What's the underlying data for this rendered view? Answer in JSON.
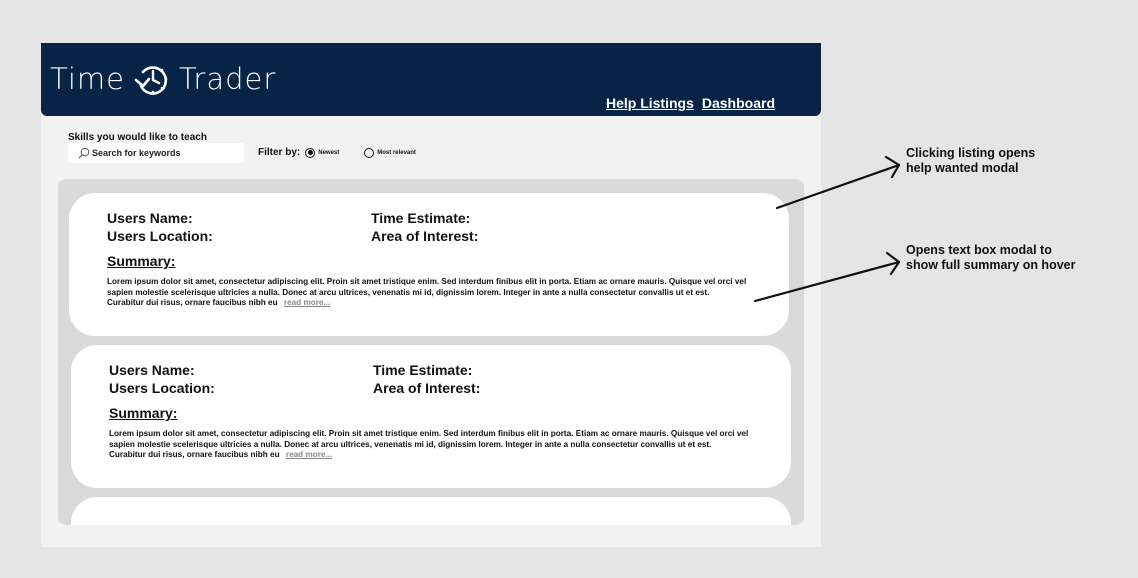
{
  "brand": {
    "left": "Time",
    "right": "Trader",
    "logo_icon": "clock-arrow-icon"
  },
  "nav": {
    "help_listings": "Help Listings",
    "dashboard": "Dashboard"
  },
  "toolbar": {
    "skills_label": "Skills you would like to teach",
    "search_placeholder": "Search for keywords",
    "filter_label": "Filter by:",
    "options": [
      {
        "label": "Newest",
        "selected": true
      },
      {
        "label": "Most relevant",
        "selected": false
      }
    ]
  },
  "listings": [
    {
      "name_label": "Users Name:",
      "location_label": "Users Location:",
      "time_label": "Time Estimate:",
      "area_label": "Area of Interest:",
      "summary_heading": "Summary:",
      "summary_text": "Lorem ipsum dolor sit amet, consectetur adipiscing elit. Proin sit amet tristique enim. Sed interdum finibus elit in porta. Etiam ac ornare mauris. Quisque vel orci vel sapien molestie scelerisque ultricies a nulla. Donec at arcu ultrices, venenatis mi id, dignissim lorem. Integer in ante a nulla consectetur convallis ut et est. Curabitur dui risus, ornare faucibus nibh eu",
      "read_more": "read more..."
    },
    {
      "name_label": "Users Name:",
      "location_label": "Users Location:",
      "time_label": "Time Estimate:",
      "area_label": "Area of Interest:",
      "summary_heading": "Summary:",
      "summary_text": "Lorem ipsum dolor sit amet, consectetur adipiscing elit. Proin sit amet tristique enim. Sed interdum finibus elit in porta. Etiam ac ornare mauris. Quisque vel orci vel sapien molestie scelerisque ultricies a nulla. Donec at arcu ultrices, venenatis mi id, dignissim lorem. Integer in ante a nulla consectetur convallis ut et est. Curabitur dui risus, ornare faucibus nibh eu",
      "read_more": "read more..."
    }
  ],
  "annotations": {
    "note_1_line_1": "Clicking listing opens",
    "note_1_line_2": "help wanted modal",
    "note_2_line_1": "Opens text box modal to",
    "note_2_line_2": "show full summary on hover"
  },
  "colors": {
    "header": "#072446",
    "background": "#e5e5e5",
    "panel": "#f2f2f2",
    "list_bg": "#d9d9d9",
    "card": "#ffffff",
    "read_more": "#8a8a8a"
  }
}
